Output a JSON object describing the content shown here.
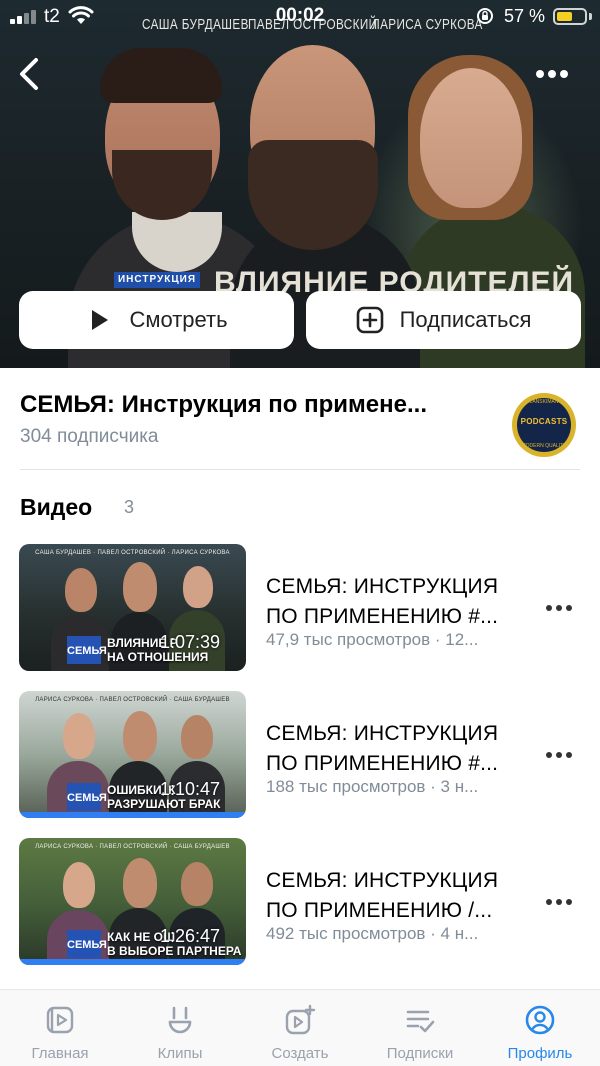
{
  "status_bar": {
    "carrier": "t2",
    "time": "00:02",
    "battery_percent": "57 %",
    "battery_level": 0.57
  },
  "hero": {
    "poster_names": [
      "САША БУРДАШЕВ",
      "ПАВЕЛ ОСТРОВСКИЙ",
      "ЛАРИСА СУРКОВА"
    ],
    "poster_tag": "ИНСТРУКЦИЯ",
    "poster_title": "ВЛИЯНИЕ РОДИТЕЛЕЙ",
    "watch_label": "Смотреть",
    "subscribe_label": "Подписаться",
    "icons": {
      "back": "chevron-left-icon",
      "more": "more-horizontal-icon",
      "watch": "play-icon",
      "subscribe": "add-square-icon"
    }
  },
  "channel": {
    "title": "СЕМЬЯ: Инструкция по примене...",
    "subscribers": "304 подписчика",
    "avatar": {
      "top_text": "LANSKIMAN",
      "center_text": "PODCASTS",
      "bottom_text": "MODERN QUALITY"
    }
  },
  "videos_section": {
    "title": "Видео",
    "count": "3",
    "items": [
      {
        "title_line1": "СЕМЬЯ: ИНСТРУКЦИЯ",
        "title_line2": "ПО ПРИМЕНЕНИЮ #...",
        "meta": "47,9 тыс просмотров · 12...",
        "duration": "1:07:39",
        "thumb_names": "САША БУРДАШЕВ · ПАВЕЛ ОСТРОВСКИЙ · ЛАРИСА СУРКОВА",
        "thumb_tag": "СЕМЬЯ",
        "thumb_caption_1": "ВЛИЯНИЕ Р",
        "thumb_caption_2": "НА ОТНОШЕНИЯ",
        "watched_fraction": 0
      },
      {
        "title_line1": "СЕМЬЯ: ИНСТРУКЦИЯ",
        "title_line2": "ПО ПРИМЕНЕНИЮ #...",
        "meta": "188 тыс просмотров · 3 н...",
        "duration": "1:10:47",
        "thumb_names": "ЛАРИСА СУРКОВА · ПАВЕЛ ОСТРОВСКИЙ · САША БУРДАШЕВ",
        "thumb_tag": "СЕМЬЯ",
        "thumb_caption_1": "ОШИБКИ, К",
        "thumb_caption_2": "РАЗРУШАЮТ БРАК",
        "watched_fraction": 1
      },
      {
        "title_line1": "СЕМЬЯ: ИНСТРУКЦИЯ",
        "title_line2": "ПО ПРИМЕНЕНИЮ /...",
        "meta": "492 тыс просмотров · 4 н...",
        "duration": "1:26:47",
        "thumb_names": "ЛАРИСА СУРКОВА · ПАВЕЛ ОСТРОВСКИЙ · САША БУРДАШЕВ",
        "thumb_tag": "СЕМЬЯ",
        "thumb_caption_1": "КАК НЕ ОШ",
        "thumb_caption_2": "В ВЫБОРЕ ПАРТНЕРА",
        "watched_fraction": 1
      }
    ]
  },
  "bottom_nav": {
    "items": [
      {
        "label": "Главная",
        "icon": "video-library-icon"
      },
      {
        "label": "Клипы",
        "icon": "clips-icon"
      },
      {
        "label": "Создать",
        "icon": "create-video-icon"
      },
      {
        "label": "Подписки",
        "icon": "subscriptions-icon"
      },
      {
        "label": "Профиль",
        "icon": "profile-icon"
      }
    ],
    "active_index": 4
  },
  "colors": {
    "accent": "#2688eb",
    "secondary_text": "#818c99",
    "progress": "#2f7ff2",
    "battery": "#f6cf23"
  }
}
